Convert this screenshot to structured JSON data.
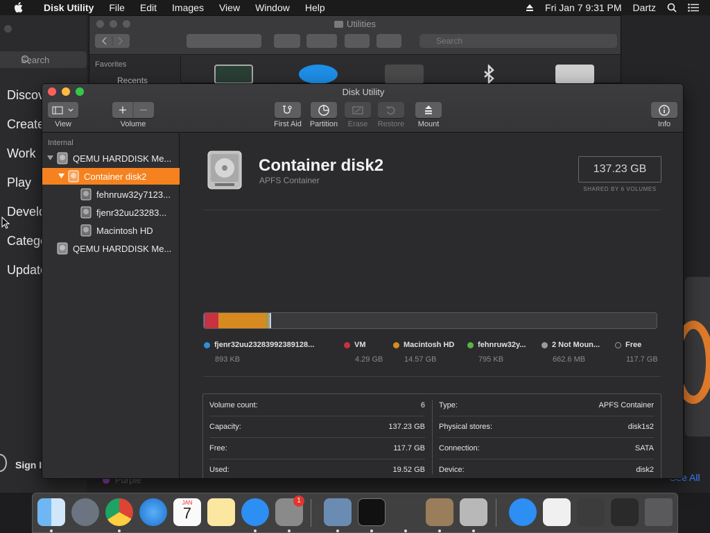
{
  "menubar": {
    "app_name": "Disk Utility",
    "items": [
      "File",
      "Edit",
      "Images",
      "View",
      "Window",
      "Help"
    ],
    "clock": "Fri Jan 7  9:31 PM",
    "user": "Dartz"
  },
  "background_app": {
    "search_placeholder": "Search",
    "nav": [
      "Discover",
      "Create",
      "Work",
      "Play",
      "Develop",
      "Categories",
      "Updates"
    ],
    "sign_in": "Sign In",
    "see_all": "See All",
    "purple_label": "Purple"
  },
  "finder": {
    "title": "Utilities",
    "search_placeholder": "Search",
    "favorites_label": "Favorites",
    "recents_label": "Recents"
  },
  "disk_utility": {
    "window_title": "Disk Utility",
    "toolbar": {
      "view_label": "View",
      "volume_label": "Volume",
      "first_aid_label": "First Aid",
      "partition_label": "Partition",
      "erase_label": "Erase",
      "restore_label": "Restore",
      "mount_label": "Mount",
      "info_label": "Info"
    },
    "sidebar": {
      "section": "Internal",
      "rows": [
        {
          "label": "QEMU HARDDISK Me..."
        },
        {
          "label": "Container disk2"
        },
        {
          "label": "fehnruw32y7123..."
        },
        {
          "label": "fjenr32uu23283..."
        },
        {
          "label": "Macintosh HD"
        },
        {
          "label": "QEMU HARDDISK Me..."
        }
      ]
    },
    "detail": {
      "title": "Container disk2",
      "subtitle": "APFS Container",
      "size": "137.23 GB",
      "shared": "SHARED BY 6 VOLUMES",
      "usage": [
        {
          "name": "fjenr32uu23283992389128...",
          "size": "893 KB",
          "color": "#2f8fd8",
          "fraction": 0.001
        },
        {
          "name": "VM",
          "size": "4.29 GB",
          "color": "#c8313f",
          "fraction": 0.031
        },
        {
          "name": "Macintosh HD",
          "size": "14.57 GB",
          "color": "#d78a1f",
          "fraction": 0.106
        },
        {
          "name": "fehnruw32y...",
          "size": "795 KB",
          "color": "#57b443",
          "fraction": 0.001
        },
        {
          "name": "2 Not Moun...",
          "size": "662.6 MB",
          "color": "#9a9a9a",
          "fraction": 0.005
        },
        {
          "name": "Free",
          "size": "117.7 GB",
          "color": "#3a3a3c",
          "fraction": 0.857
        }
      ],
      "info": {
        "volume_count_k": "Volume count:",
        "volume_count_v": "6",
        "capacity_k": "Capacity:",
        "capacity_v": "137.23 GB",
        "free_k": "Free:",
        "free_v": "117.7 GB",
        "used_k": "Used:",
        "used_v": "19.52 GB",
        "type_k": "Type:",
        "type_v": "APFS Container",
        "physical_k": "Physical stores:",
        "physical_v": "disk1s2",
        "connection_k": "Connection:",
        "connection_v": "SATA",
        "device_k": "Device:",
        "device_v": "disk2"
      }
    }
  },
  "dock": {
    "apps": [
      "finder-icon",
      "launchpad-icon",
      "chrome-icon",
      "safari-icon",
      "calendar-icon",
      "notes-icon",
      "app-store-icon",
      "system-preferences-icon",
      "preview-icon",
      "terminal-icon",
      "instruments-icon",
      "calculator-icon",
      "disk-utility-icon",
      "app-store-icon",
      "game-icon",
      "game-icon",
      "screenshot-icon",
      "screenshot-icon",
      "trash-icon"
    ],
    "calendar_month": "JAN",
    "calendar_day": "7",
    "prefs_badge": "1"
  },
  "colors": {
    "selection": "#f5821f",
    "close": "#fc605c",
    "minimize": "#fdbc40",
    "zoom": "#34c84a"
  }
}
